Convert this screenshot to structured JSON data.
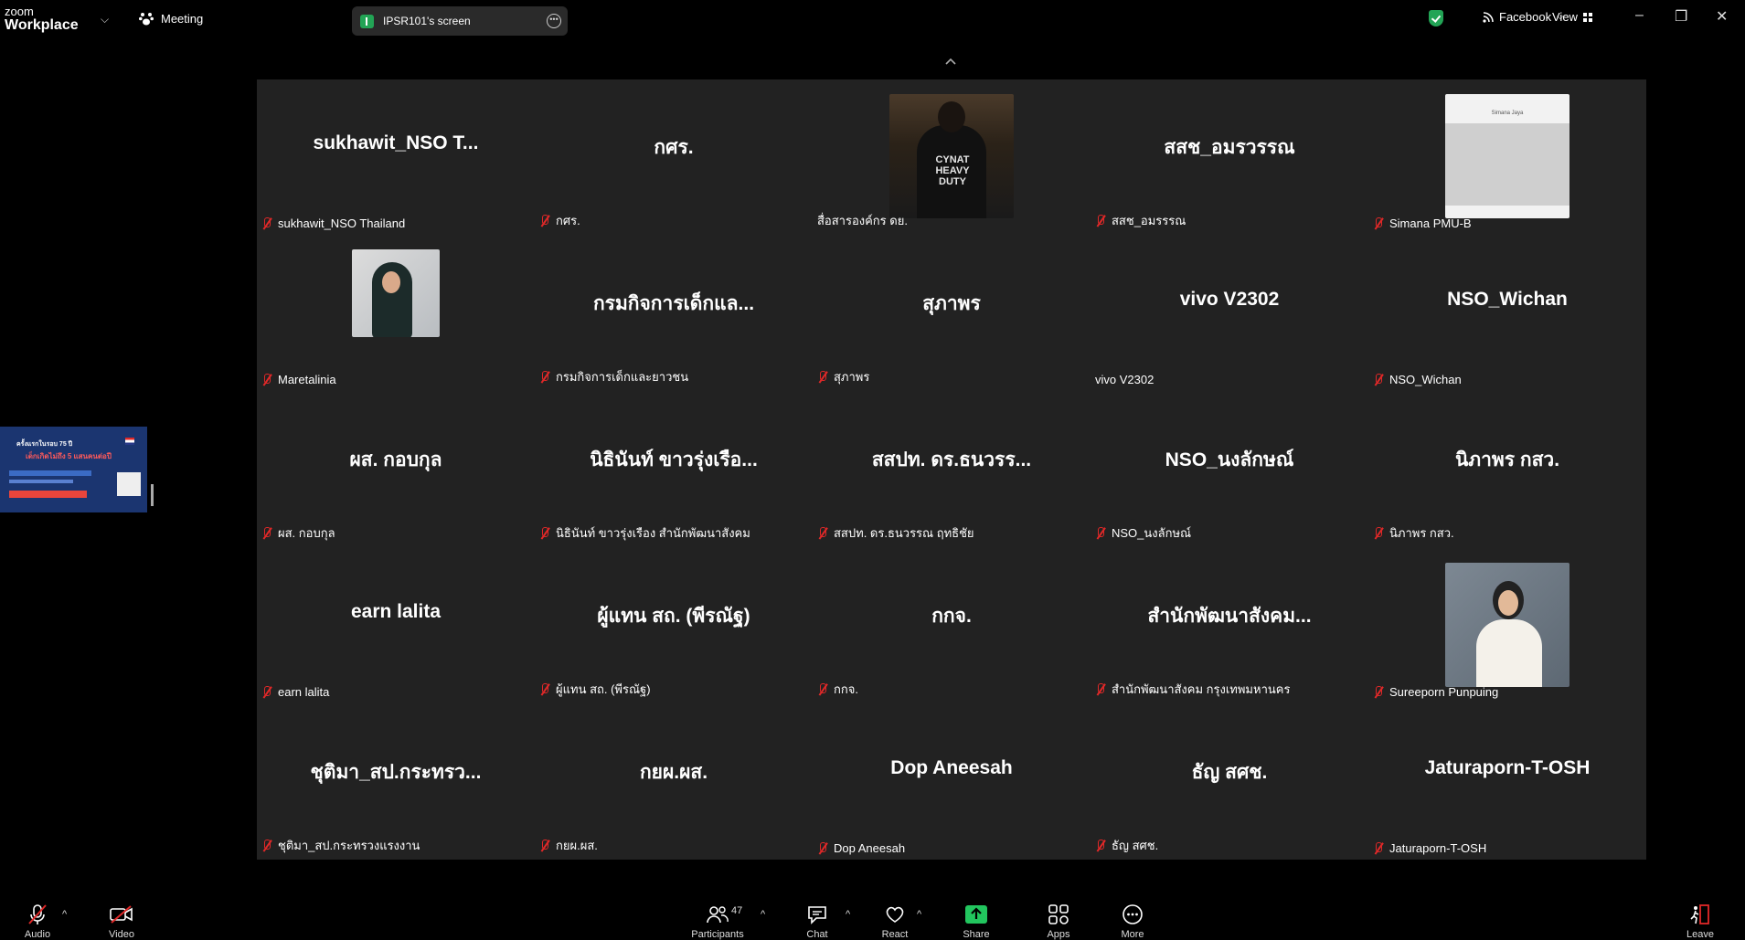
{
  "titlebar": {
    "app_line1": "zoom",
    "app_line2": "Workplace",
    "meeting_label": "Meeting",
    "screen_share_label": "IPSR101's screen",
    "stream_label": "Facebook",
    "view_label": "View"
  },
  "participants": [
    {
      "name": "sukhawit_NSO  T...",
      "label": "sukhawit_NSO Thailand",
      "muted": true
    },
    {
      "name": "กศร.",
      "label": "กศร.",
      "muted": true
    },
    {
      "name": "",
      "label": "สื่อสารองค์กร ดย.",
      "muted": false,
      "video": "cynat"
    },
    {
      "name": "สสช_อมรวรรณ",
      "label": "สสช_อมรรรณ",
      "muted": true
    },
    {
      "name": "",
      "label": "Simana PMU-B",
      "muted": true,
      "video": "simana"
    },
    {
      "name": "",
      "label": "Maretalinia",
      "muted": true,
      "video": "woman-hijab"
    },
    {
      "name": "กรมกิจการเด็กแล...",
      "label": "กรมกิจการเด็กและยาวชน",
      "muted": true
    },
    {
      "name": "สุภาพร",
      "label": "สุภาพร",
      "muted": true
    },
    {
      "name": "vivo V2302",
      "label": "vivo V2302",
      "muted": false
    },
    {
      "name": "NSO_Wichan",
      "label": "NSO_Wichan",
      "muted": true
    },
    {
      "name": "ผส. กอบกุล",
      "label": "ผส. กอบกุล",
      "muted": true
    },
    {
      "name": "นิธินันท์ ขาวรุ่งเรือ...",
      "label": "นิธินันท์ ขาวรุ่งเรือง สำนักพัฒนาสังคม",
      "muted": true
    },
    {
      "name": "สสปท. ดร.ธนวรร...",
      "label": "สสปท. ดร.ธนวรรณ ฤทธิชัย",
      "muted": true
    },
    {
      "name": "NSO_นงลักษณ์",
      "label": "NSO_นงลักษณ์",
      "muted": true
    },
    {
      "name": "นิภาพร กสว.",
      "label": "นิภาพร กสว.",
      "muted": true
    },
    {
      "name": "earn lalita",
      "label": "earn lalita",
      "muted": true
    },
    {
      "name": "ผู้แทน สถ. (พีรณัฐ)",
      "label": "ผู้แทน สถ. (พีรณัฐ)",
      "muted": true
    },
    {
      "name": "กกจ.",
      "label": "กกจ.",
      "muted": true
    },
    {
      "name": "สำนักพัฒนาสังคม...",
      "label": "สำนักพัฒนาสังคม กรุงเทพมหานคร",
      "muted": true
    },
    {
      "name": "",
      "label": "Sureeporn Punpuing",
      "muted": true,
      "video": "woman-white"
    },
    {
      "name": "ชุติมา_สป.กระทรว...",
      "label": "ชุติมา_สป.กระทรวงแรงงาน",
      "muted": true
    },
    {
      "name": "กยผ.ผส.",
      "label": "กยผ.ผส.",
      "muted": true
    },
    {
      "name": "Dop Aneesah",
      "label": "Dop Aneesah",
      "muted": true
    },
    {
      "name": "ธัญ สศช.",
      "label": "ธัญ สศช.",
      "muted": true
    },
    {
      "name": "Jaturaporn-T-OSH",
      "label": "Jaturaporn-T-OSH",
      "muted": true
    }
  ],
  "video_text": {
    "cynat": "CYNAT HEAVY DUTY",
    "simana_header": "Simana Jaya"
  },
  "thumbnail": {
    "headline": "ครั้งแรกในรอบ 75 ปี",
    "subline": "เด็กเกิดไม่ถึง 5 แสนคนต่อปี"
  },
  "toolbar": {
    "audio": "Audio",
    "video": "Video",
    "participants": "Participants",
    "participants_count": "47",
    "chat": "Chat",
    "react": "React",
    "share": "Share",
    "apps": "Apps",
    "more": "More",
    "leave": "Leave"
  },
  "colors": {
    "background": "#000000",
    "tile": "#222222",
    "mute_red": "#e02828",
    "share_green": "#22a455"
  }
}
